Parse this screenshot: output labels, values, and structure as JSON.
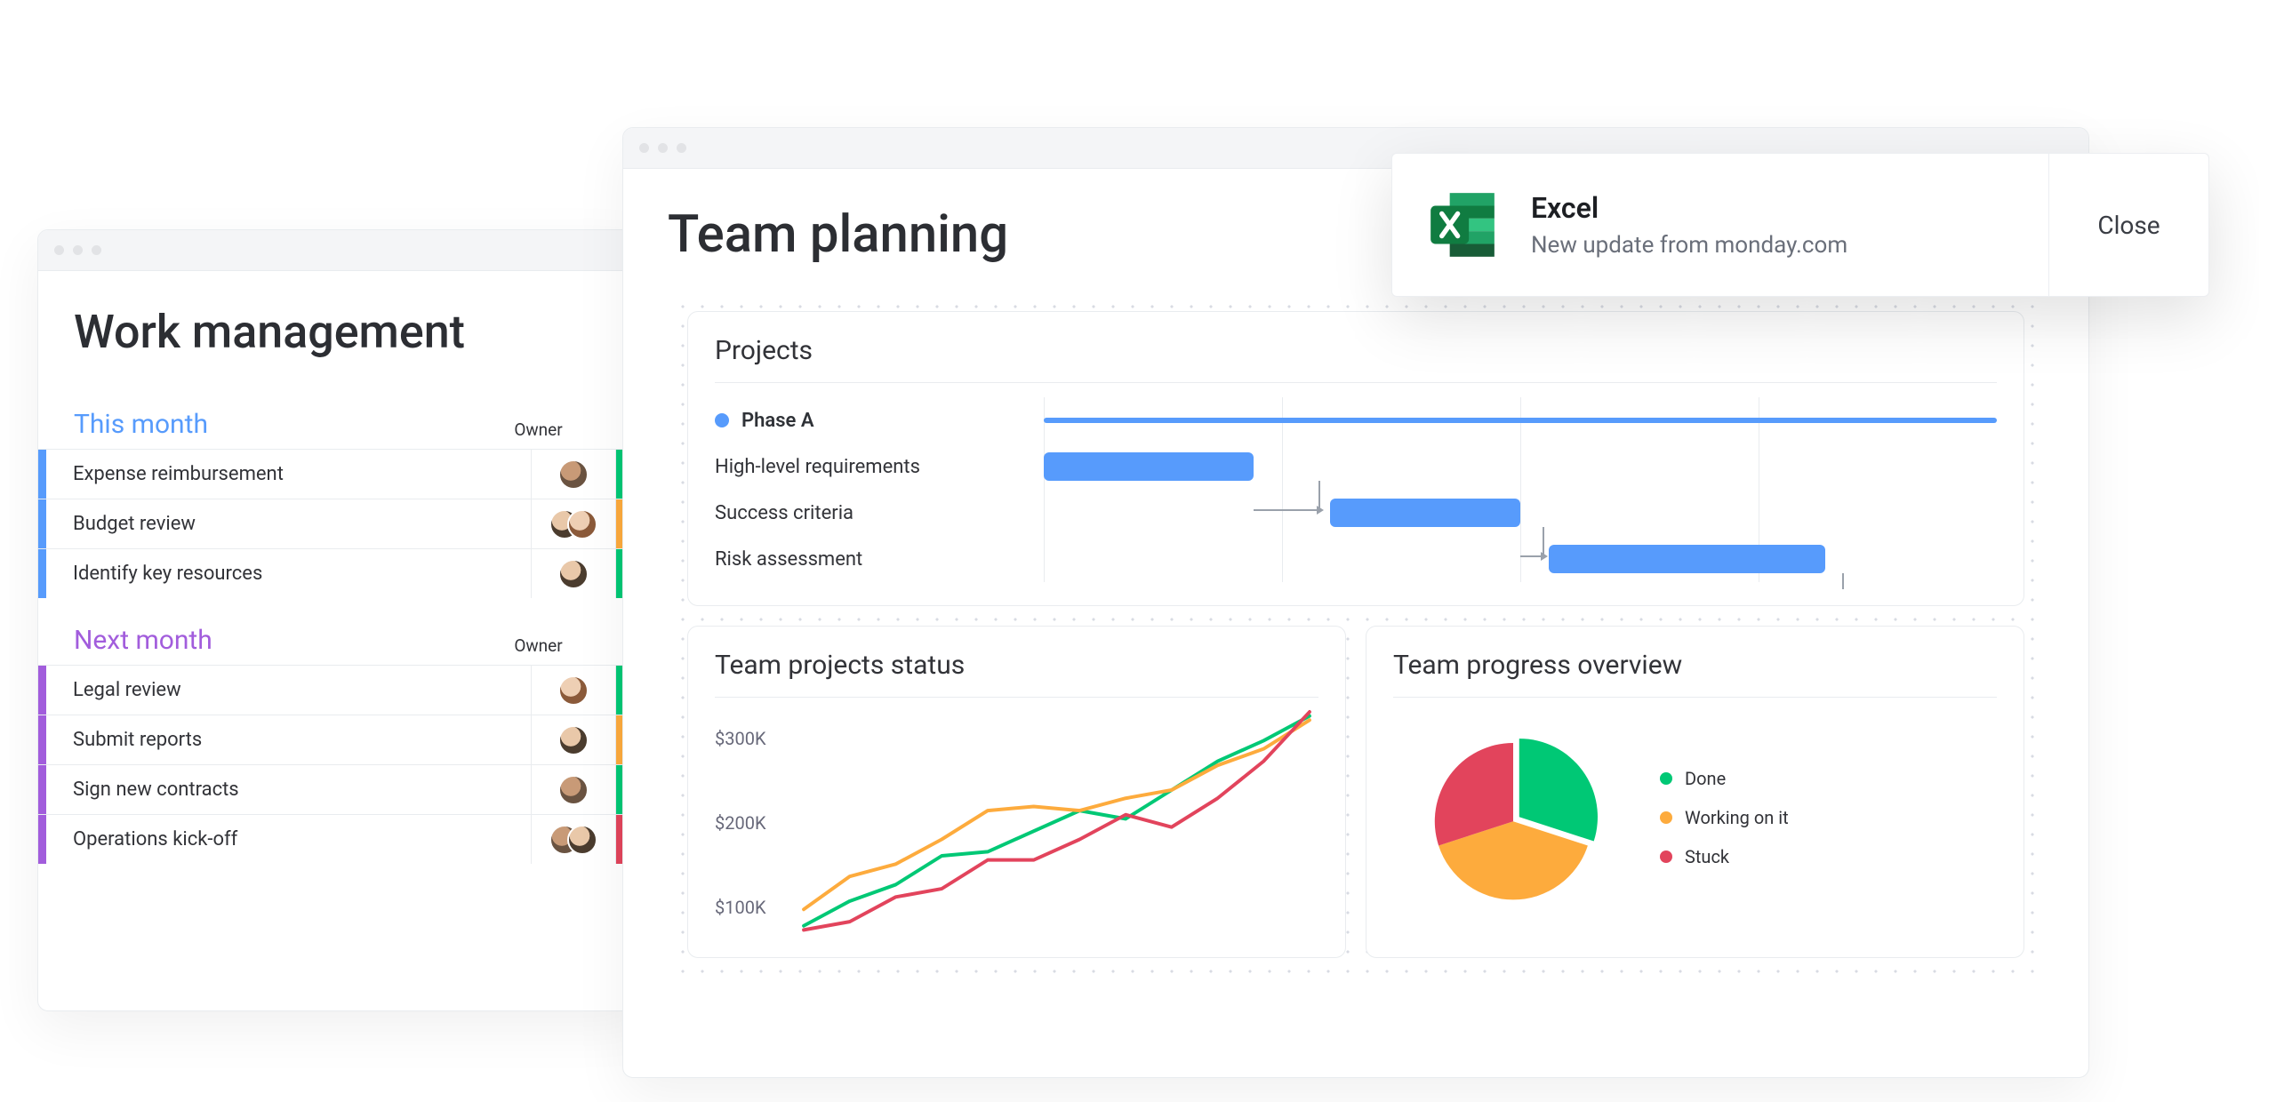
{
  "work_mgmt": {
    "title": "Work management",
    "owner_col": "Owner",
    "groups": [
      {
        "name": "This month",
        "accent": "blue",
        "rows": [
          {
            "label": "Expense reimbursement",
            "status": "green"
          },
          {
            "label": "Budget review",
            "status": "orange"
          },
          {
            "label": "Identify key resources",
            "status": "green"
          }
        ]
      },
      {
        "name": "Next month",
        "accent": "purple",
        "rows": [
          {
            "label": "Legal review",
            "status": "green"
          },
          {
            "label": "Submit reports",
            "status": "orange"
          },
          {
            "label": "Sign new contracts",
            "status": "green"
          },
          {
            "label": "Operations kick-off",
            "status": "red"
          }
        ]
      }
    ]
  },
  "team_planning": {
    "title": "Team planning",
    "projects": {
      "title": "Projects",
      "phase_label": "Phase A",
      "rows": [
        "High-level requirements",
        "Success criteria",
        "Risk assessment"
      ]
    },
    "status_chart": {
      "title": "Team projects status"
    },
    "progress_pie": {
      "title": "Team progress overview",
      "legend": [
        "Done",
        "Working on it",
        "Stuck"
      ]
    }
  },
  "toast": {
    "title": "Excel",
    "subtitle": "New update from monday.com",
    "close": "Close"
  },
  "chart_data": [
    {
      "type": "bar",
      "note": "Gantt-style timeline; track spans 0–100 units",
      "series": [
        {
          "name": "Phase A",
          "start": 0,
          "end": 100,
          "style": "thin"
        },
        {
          "name": "High-level requirements",
          "start": 0,
          "end": 22
        },
        {
          "name": "Success criteria",
          "start": 30,
          "end": 50
        },
        {
          "name": "Risk assessment",
          "start": 53,
          "end": 82
        }
      ],
      "dependencies": [
        [
          1,
          2
        ],
        [
          2,
          3
        ]
      ]
    },
    {
      "type": "line",
      "title": "Team projects status",
      "ylabel": "USD",
      "ylim": [
        50000,
        320000
      ],
      "yticks": [
        "$100K",
        "$200K",
        "$300K"
      ],
      "x": [
        0,
        1,
        2,
        3,
        4,
        5,
        6,
        7,
        8,
        9,
        10,
        11
      ],
      "series": [
        {
          "name": "green",
          "color": "#00c875",
          "values": [
            60000,
            90000,
            110000,
            145000,
            150000,
            175000,
            200000,
            190000,
            225000,
            260000,
            285000,
            315000
          ]
        },
        {
          "name": "orange",
          "color": "#fdab3d",
          "values": [
            80000,
            120000,
            135000,
            165000,
            200000,
            205000,
            200000,
            215000,
            225000,
            255000,
            275000,
            310000
          ]
        },
        {
          "name": "red",
          "color": "#e2445c",
          "values": [
            55000,
            65000,
            95000,
            105000,
            140000,
            140000,
            165000,
            195000,
            180000,
            215000,
            260000,
            320000
          ]
        }
      ]
    },
    {
      "type": "pie",
      "title": "Team progress overview",
      "series": [
        {
          "name": "Done",
          "value": 30,
          "color": "#00c875"
        },
        {
          "name": "Working on it",
          "value": 40,
          "color": "#fdab3d"
        },
        {
          "name": "Stuck",
          "value": 30,
          "color": "#e2445c"
        }
      ]
    }
  ]
}
